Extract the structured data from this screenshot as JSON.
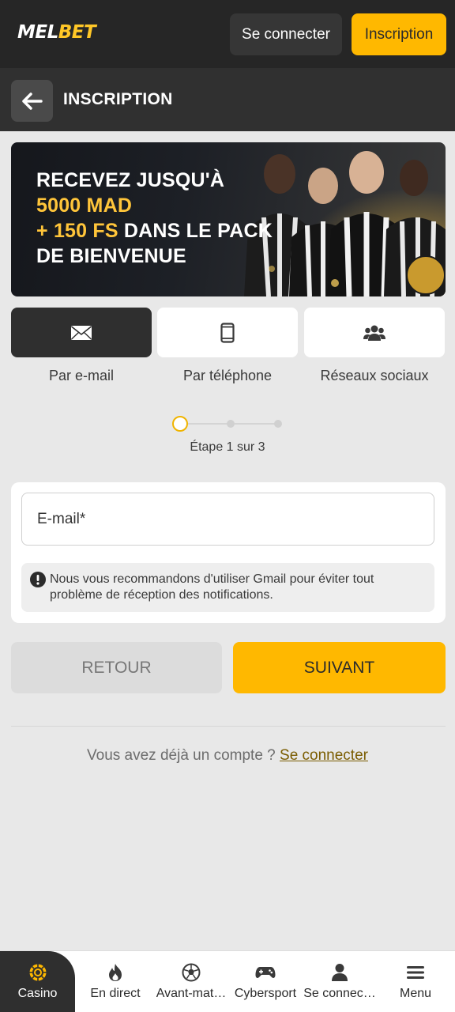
{
  "header": {
    "logo_main": "MEL",
    "logo_accent": "BET",
    "login_label": "Se connecter",
    "register_label": "Inscription"
  },
  "titlebar": {
    "title": "INSCRIPTION"
  },
  "banner": {
    "line1": "RECEVEZ JUSQU'À",
    "line2": "5000 MAD",
    "line3_highlight": "+ 150 FS",
    "line3_rest": " DANS LE PACK",
    "line4": "DE BIENVENUE"
  },
  "methods": [
    {
      "label": "Par e-mail",
      "icon": "envelope-icon",
      "active": true
    },
    {
      "label": "Par téléphone",
      "icon": "phone-icon",
      "active": false
    },
    {
      "label": "Réseaux sociaux",
      "icon": "users-icon",
      "active": false
    }
  ],
  "stepper": {
    "text": "Étape 1 sur 3",
    "current": 1,
    "total": 3
  },
  "form": {
    "email_placeholder": "E-mail*",
    "email_value": "",
    "notice": "Nous vous recommandons d'utiliser Gmail pour éviter tout problème de réception des notifications."
  },
  "actions": {
    "back_label": "RETOUR",
    "next_label": "SUIVANT"
  },
  "login_prompt": {
    "text": "Vous avez déjà un compte ? ",
    "link": "Se connecter"
  },
  "bottom_nav": [
    {
      "label": "Casino",
      "icon": "casino-chip-icon",
      "active": true
    },
    {
      "label": "En direct",
      "icon": "flame-icon",
      "active": false
    },
    {
      "label": "Avant-mat…",
      "icon": "soccer-ball-icon",
      "active": false
    },
    {
      "label": "Cybersport",
      "icon": "gamepad-icon",
      "active": false
    },
    {
      "label": "Se connec…",
      "icon": "user-icon",
      "active": false
    },
    {
      "label": "Menu",
      "icon": "menu-icon",
      "active": false
    }
  ],
  "colors": {
    "accent": "#ffb800",
    "dark": "#262626",
    "background": "#e8e8e8"
  }
}
